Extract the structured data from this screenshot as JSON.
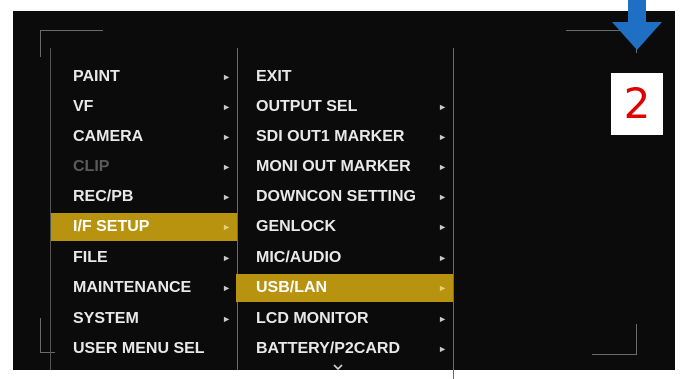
{
  "left_menu": {
    "items": [
      {
        "label": "PAINT",
        "arrow": "►"
      },
      {
        "label": "VF",
        "arrow": "►"
      },
      {
        "label": "CAMERA",
        "arrow": "►"
      },
      {
        "label": "CLIP",
        "arrow": "►",
        "state": "disabled"
      },
      {
        "label": "REC/PB",
        "arrow": "►"
      },
      {
        "label": "I/F SETUP",
        "arrow": "►",
        "state": "selected"
      },
      {
        "label": "FILE",
        "arrow": "►"
      },
      {
        "label": "MAINTENANCE",
        "arrow": "►"
      },
      {
        "label": "SYSTEM",
        "arrow": "►"
      },
      {
        "label": "USER MENU SEL",
        "arrow": ""
      }
    ]
  },
  "right_menu": {
    "items": [
      {
        "label": "EXIT",
        "arrow": ""
      },
      {
        "label": "OUTPUT SEL",
        "arrow": "►"
      },
      {
        "label": "SDI OUT1 MARKER",
        "arrow": "►"
      },
      {
        "label": "MONI OUT MARKER",
        "arrow": "►"
      },
      {
        "label": "DOWNCON SETTING",
        "arrow": "►"
      },
      {
        "label": "GENLOCK",
        "arrow": "►"
      },
      {
        "label": "MIC/AUDIO",
        "arrow": "►"
      },
      {
        "label": "USB/LAN",
        "arrow": "►",
        "state": "selected"
      },
      {
        "label": "LCD MONITOR",
        "arrow": "►"
      },
      {
        "label": "BATTERY/P2CARD",
        "arrow": "►"
      }
    ]
  },
  "scroll_indicator_icon": "chevron-down-icon",
  "callout": {
    "number": "2",
    "arrow_icon": "down-arrow-icon",
    "arrow_color": "#1f6fc4",
    "number_color": "#e00000"
  },
  "colors": {
    "highlight": "#b7930f",
    "screen_background": "#0b0b0b"
  }
}
